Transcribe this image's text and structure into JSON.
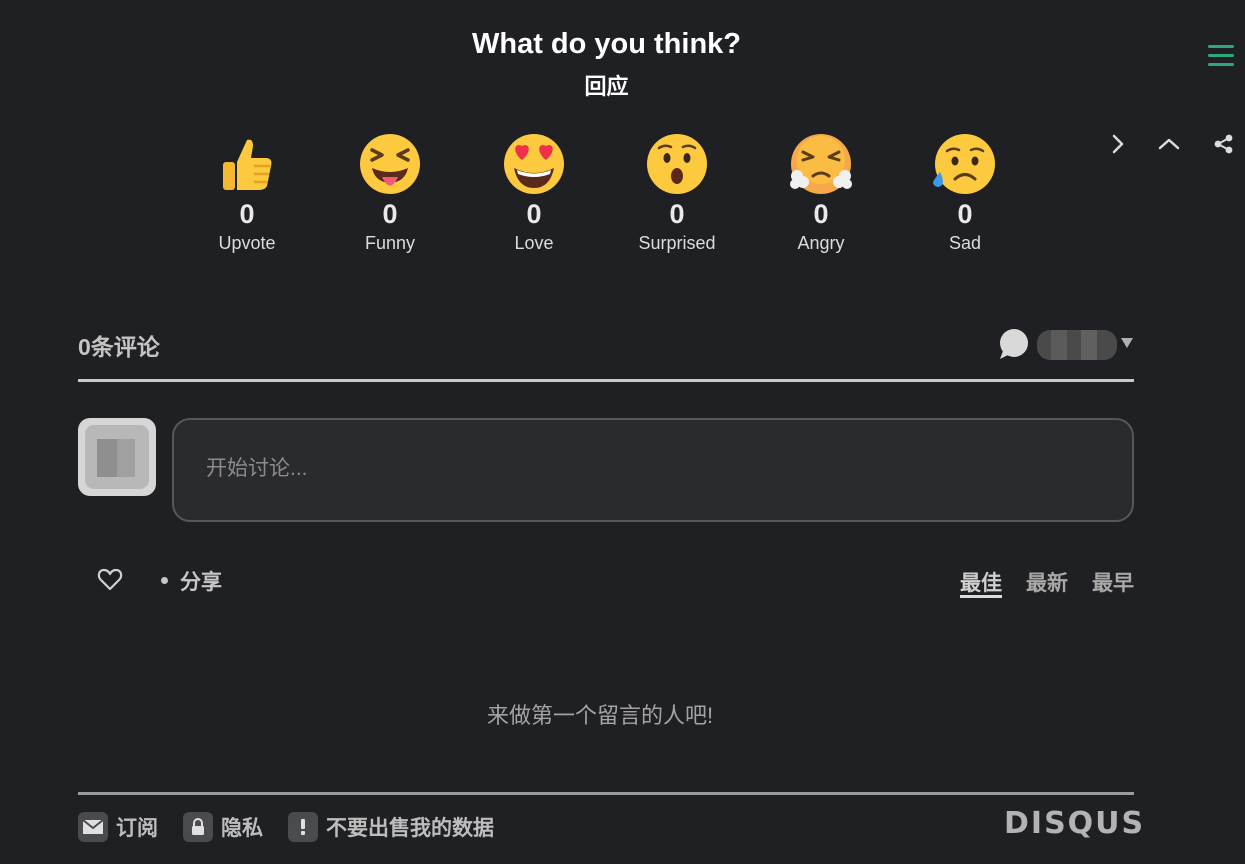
{
  "header": {
    "title": "What do you think?",
    "subtitle": "回应"
  },
  "top_controls": {
    "icons": [
      "hamburger-icon",
      "chevron-right-icon",
      "chevron-up-icon",
      "share-icon"
    ],
    "accent": "#2ea87b"
  },
  "reactions": [
    {
      "label": "Upvote",
      "count": "0",
      "icon": "thumbs-up-emoji"
    },
    {
      "label": "Funny",
      "count": "0",
      "icon": "laughing-tongue-emoji"
    },
    {
      "label": "Love",
      "count": "0",
      "icon": "heart-eyes-emoji"
    },
    {
      "label": "Surprised",
      "count": "0",
      "icon": "hushed-face-emoji"
    },
    {
      "label": "Angry",
      "count": "0",
      "icon": "steam-from-nose-emoji"
    },
    {
      "label": "Sad",
      "count": "0",
      "icon": "sad-sweat-emoji"
    }
  ],
  "comments": {
    "count_label": "0条评论",
    "composer_placeholder": "开始讨论...",
    "share_label": "分享",
    "sort_options": [
      "最佳",
      "最新",
      "最早"
    ],
    "active_sort": "最佳",
    "empty_message": "来做第一个留言的人吧!"
  },
  "footer": {
    "subscribe": "订阅",
    "privacy": "隐私",
    "do_not_sell": "不要出售我的数据",
    "brand": "DISQUS"
  },
  "colors": {
    "background": "#1f2023",
    "text": "#e6e6e6",
    "accent": "#2ea87b"
  }
}
